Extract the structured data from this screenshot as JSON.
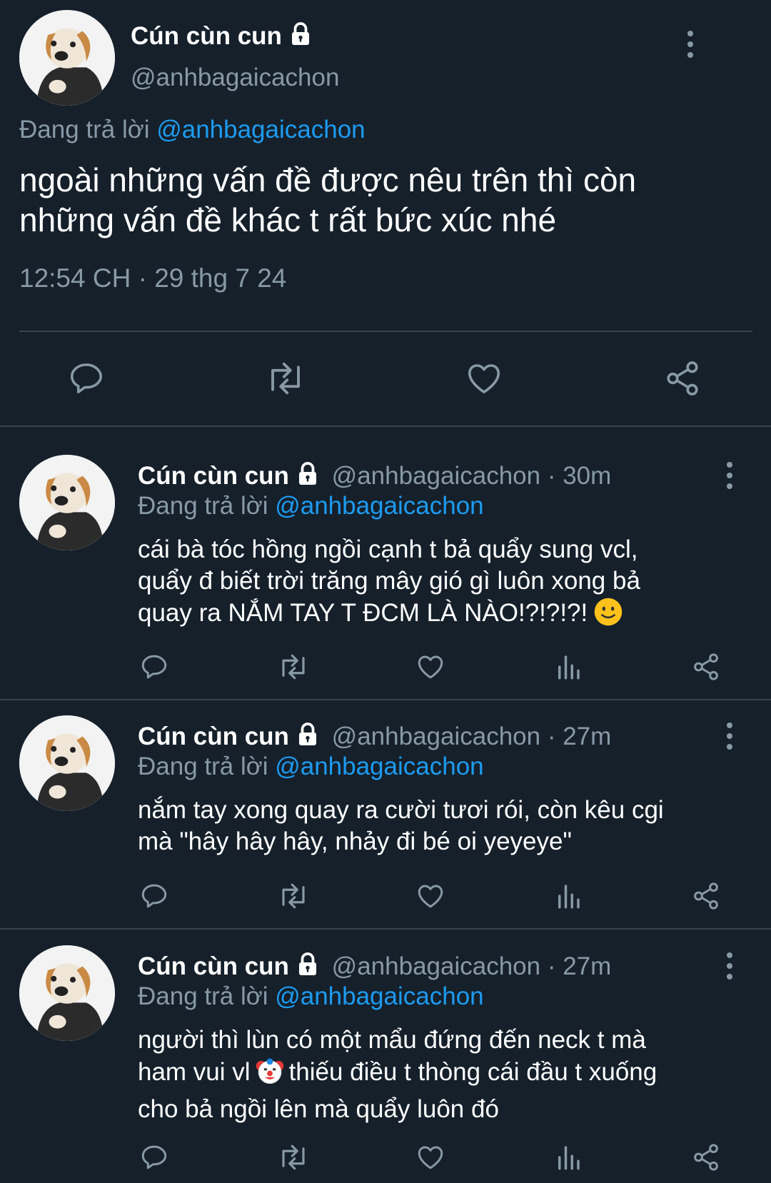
{
  "main_tweet": {
    "display_name": "Cún cùn cun",
    "handle": "@anhbagaicachon",
    "reply_prefix": "Đang trả lời",
    "reply_to": "@anhbagaicachon",
    "text_line1": "ngoài những vấn đề được nêu trên thì còn",
    "text_line2": "những vấn đề khác t rất bức xúc nhé",
    "timestamp": "12:54 CH · 29 thg 7 24"
  },
  "replies": [
    {
      "display_name": "Cún cùn cun",
      "handle_time": "@anhbagaicachon · 30m",
      "reply_prefix": "Đang trả lời",
      "reply_to": "@anhbagaicachon",
      "line1": "cái bà tóc hồng ngồi cạnh t bả quẩy sung vcl,",
      "line2": "quẩy đ biết trời trăng mây gió gì luôn xong bả",
      "line3": "quay ra NẮM TAY T ĐCM LÀ NÀO!?!?!?!",
      "emoji": "slightly-smiling-face"
    },
    {
      "display_name": "Cún cùn cun",
      "handle_time": "@anhbagaicachon · 27m",
      "reply_prefix": "Đang trả lời",
      "reply_to": "@anhbagaicachon",
      "line1": "nắm tay xong quay ra cười tươi rói, còn kêu cgi",
      "line2": "mà \"hây hây hây, nhảy đi bé oi yeyeye\""
    },
    {
      "display_name": "Cún cùn cun",
      "handle_time": "@anhbagaicachon · 27m",
      "reply_prefix": "Đang trả lời",
      "reply_to": "@anhbagaicachon",
      "line1": "người thì lùn có một mẩu đứng đến neck t mà",
      "line2a": "ham vui vl",
      "line2b": "thiếu điều t thòng cái đầu t xuống",
      "line3": "cho bả ngồi lên mà quẩy luôn đó",
      "emoji": "clown-face"
    }
  ],
  "colors": {
    "background": "#15202b",
    "text": "#ffffff",
    "muted": "#8899a6",
    "link": "#1d9bf0",
    "divider": "#38444d"
  }
}
